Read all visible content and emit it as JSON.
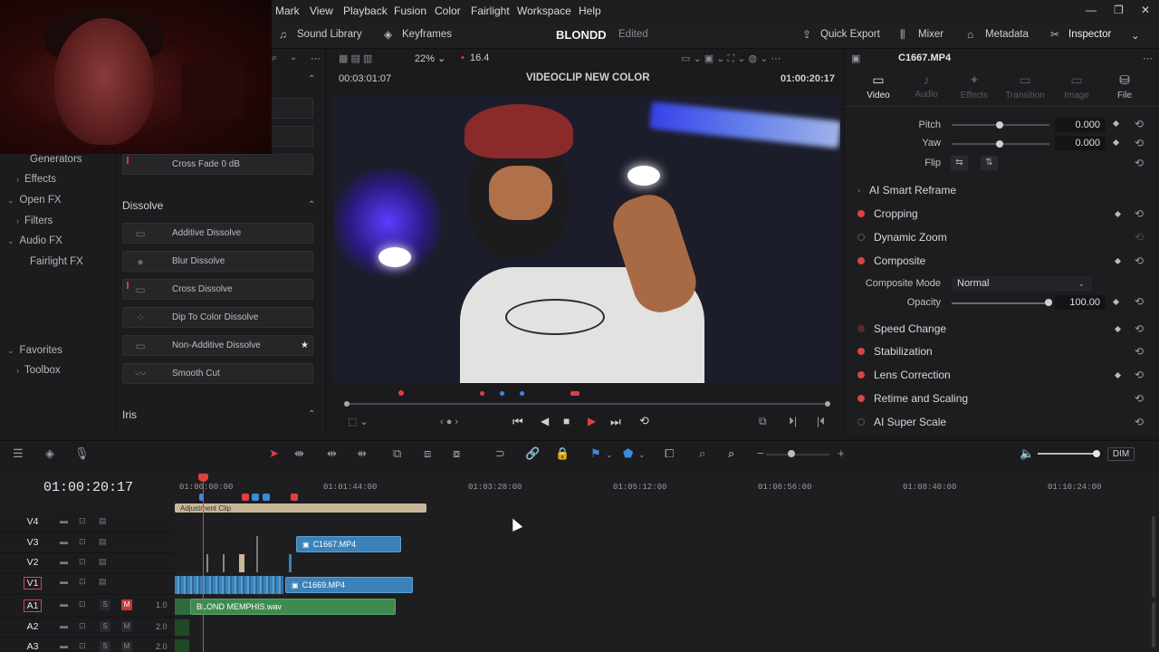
{
  "menu": [
    "Mark",
    "View",
    "Playback",
    "Fusion",
    "Color",
    "Fairlight",
    "Workspace",
    "Help"
  ],
  "toolbar": {
    "sound_library": "Sound Library",
    "keyframes": "Keyframes",
    "project_title": "BLONDD",
    "project_status": "Edited",
    "quick_export": "Quick Export",
    "mixer": "Mixer",
    "metadata": "Metadata",
    "inspector": "Inspector"
  },
  "left_tree": {
    "generators": "Generators",
    "effects": "Effects",
    "open_fx": "Open FX",
    "filters": "Filters",
    "audio_fx": "Audio FX",
    "fairlight_fx": "Fairlight FX",
    "favorites": "Favorites",
    "toolbox": "Toolbox"
  },
  "fx_list": {
    "cross_fade": "Cross Fade 0 dB",
    "dissolve_header": "Dissolve",
    "items": [
      "Additive Dissolve",
      "Blur Dissolve",
      "Cross Dissolve",
      "Dip To Color Dissolve",
      "Non-Additive Dissolve",
      "Smooth Cut"
    ],
    "iris_header": "Iris"
  },
  "viewer": {
    "zoom": "22%",
    "fps": "16.4",
    "source_tc": "00:03:01:07",
    "clip_name": "VIDEOCLIP NEW COLOR",
    "record_tc": "01:00:20:17"
  },
  "inspector": {
    "clip_name": "C1667.MP4",
    "tabs": [
      "Video",
      "Audio",
      "Effects",
      "Transition",
      "Image",
      "File"
    ],
    "pitch_label": "Pitch",
    "pitch_value": "0.000",
    "yaw_label": "Yaw",
    "yaw_value": "0.000",
    "flip_label": "Flip",
    "ai_smart_reframe": "AI Smart Reframe",
    "cropping": "Cropping",
    "dynamic_zoom": "Dynamic Zoom",
    "composite": "Composite",
    "composite_mode_label": "Composite Mode",
    "composite_mode_value": "Normal",
    "opacity_label": "Opacity",
    "opacity_value": "100.00",
    "speed_change": "Speed Change",
    "stabilization": "Stabilization",
    "lens_correction": "Lens Correction",
    "retime_scaling": "Retime and Scaling",
    "ai_super_scale": "AI Super Scale"
  },
  "timeline": {
    "timecode": "01:00:20:17",
    "ruler": [
      "01:00:00:00",
      "01:01:44:00",
      "01:03:28:00",
      "01:05:12:00",
      "01:06:56:00",
      "01:08:40:00",
      "01:10:24:00"
    ],
    "dim": "DIM",
    "tracks": {
      "v4": "V4",
      "v3": "V3",
      "v2": "V2",
      "v1": "V1",
      "a1": "A1",
      "a2": "A2",
      "a3": "A3"
    },
    "a1_vol": "1.0",
    "a2_vol": "2.0",
    "a3_vol": "2.0",
    "clips": {
      "adjustment": "Adjustment Clip",
      "v3_clip": "C1667.MP4",
      "v1_clip": "C1669.MP4",
      "a1_clip": "BLOND MEMPHIS.wav"
    }
  },
  "colors": {
    "accent_red": "#d84545",
    "video_clip": "#3b82b8",
    "audio_clip": "#3f8a50"
  }
}
